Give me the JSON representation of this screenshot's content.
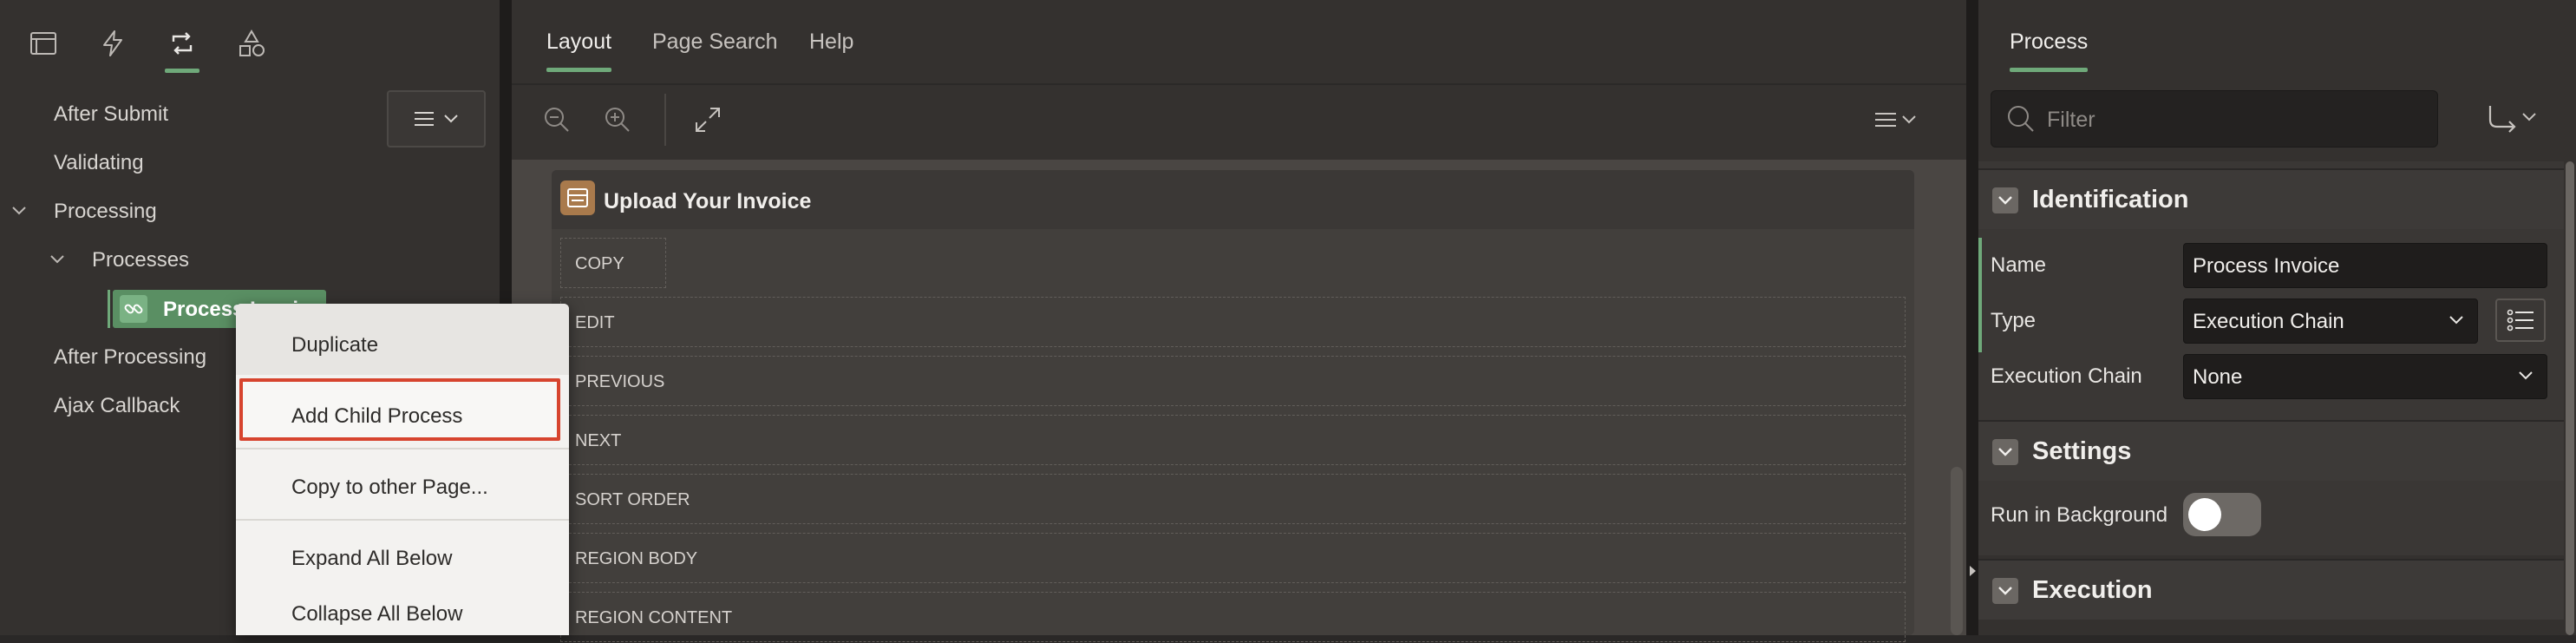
{
  "left_panel": {
    "tabs": [
      {
        "name": "rendering-tab-icon"
      },
      {
        "name": "dynamic-actions-tab-icon"
      },
      {
        "name": "processing-tab-icon"
      },
      {
        "name": "shared-components-tab-icon"
      }
    ],
    "menu_button": "menu-icon",
    "tree": {
      "after_submit": "After Submit",
      "validating": "Validating",
      "processing": "Processing",
      "processes": "Processes",
      "selected_node": "Process Invoice",
      "after_processing": "After Processing",
      "ajax_callback": "Ajax Callback"
    }
  },
  "context_menu": {
    "items": [
      "Duplicate",
      "Add Child Process",
      "Copy to other Page...",
      "Expand All Below",
      "Collapse All Below"
    ],
    "highlighted": "Add Child Process",
    "highlight_color": "#d7442e"
  },
  "center": {
    "tabs": [
      "Layout",
      "Page Search",
      "Help"
    ],
    "active_tab": "Layout",
    "region": {
      "title": "Upload Your Invoice",
      "slots": [
        "COPY",
        "EDIT",
        "PREVIOUS",
        "NEXT",
        "SORT ORDER",
        "REGION BODY",
        "REGION CONTENT"
      ]
    }
  },
  "right": {
    "tab": "Process",
    "filter_placeholder": "Filter",
    "sections": {
      "identification": "Identification",
      "settings": "Settings",
      "execution": "Execution"
    },
    "props": {
      "name_label": "Name",
      "name_value": "Process Invoice",
      "type_label": "Type",
      "type_value": "Execution Chain",
      "chain_label": "Execution Chain",
      "chain_value": "None",
      "background_label": "Run in Background",
      "background_on": false
    }
  },
  "colors": {
    "accent": "#6fa97a",
    "selected_node": "#5a8f63"
  }
}
